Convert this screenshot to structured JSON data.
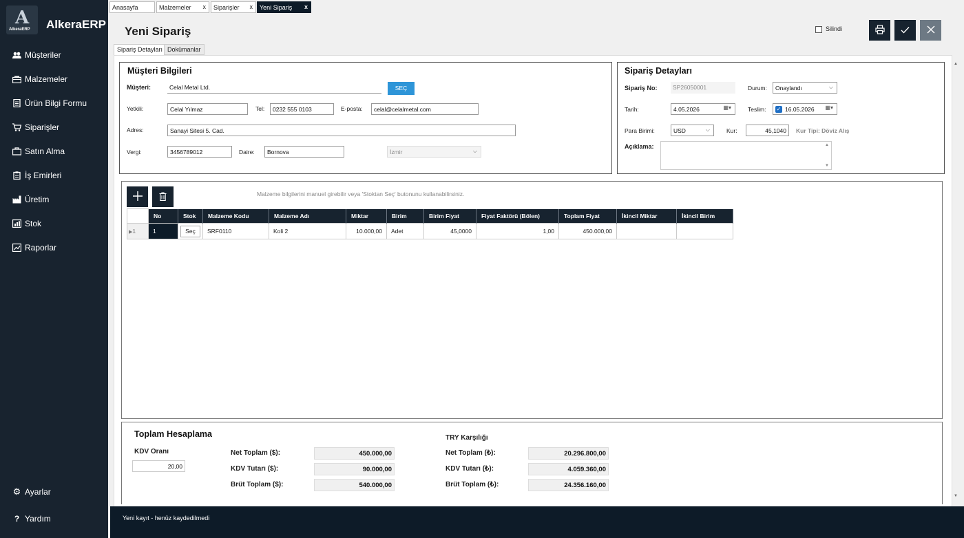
{
  "app": {
    "logo_sub": "AlkeraERP",
    "title": "AlkeraERP"
  },
  "nav": [
    {
      "label": "Müşteriler",
      "icon": "users-icon"
    },
    {
      "label": "Malzemeler",
      "icon": "box-icon"
    },
    {
      "label": "Ürün Bilgi Formu",
      "icon": "document-icon"
    },
    {
      "label": "Siparişler",
      "icon": "cart-icon"
    },
    {
      "label": "Satın Alma",
      "icon": "purchase-icon"
    },
    {
      "label": "İş Emirleri",
      "icon": "clipboard-icon"
    },
    {
      "label": "Üretim",
      "icon": "factory-icon"
    },
    {
      "label": "Stok",
      "icon": "stock-icon"
    },
    {
      "label": "Raporlar",
      "icon": "chart-icon"
    }
  ],
  "nav_bottom": [
    {
      "label": "Ayarlar",
      "icon": "gear-icon"
    },
    {
      "label": "Yardım",
      "icon": "help-icon"
    }
  ],
  "tabs": [
    {
      "label": "Anasayfa"
    },
    {
      "label": "Malzemeler",
      "close": "x"
    },
    {
      "label": "Siparişler",
      "close": "x"
    },
    {
      "label": "Yeni Sipariş",
      "close": "x"
    }
  ],
  "page": {
    "title": "Yeni Sipariş",
    "deleted_label": "Silindi"
  },
  "subtabs": [
    "Sipariş Detayları",
    "Dokümanlar"
  ],
  "customer": {
    "title": "Müşteri Bilgileri",
    "customer_label": "Müşteri:",
    "customer_value": "Celal Metal Ltd.",
    "select_button": "SEÇ",
    "contact_label": "Yetkili:",
    "contact_value": "Celal Yılmaz",
    "phone_label": "Tel:",
    "phone_value": "0232 555 0103",
    "email_label": "E-posta:",
    "email_value": "celal@celalmetal.com",
    "address_label": "Adres:",
    "address_value": "Sanayi Sitesi 5. Cad.",
    "tax_label": "Vergi:",
    "tax_value": "3456789012",
    "office_label": "Daire:",
    "office_value": "Bornova",
    "city_value": "İzmir"
  },
  "order": {
    "title": "Sipariş Detayları",
    "no_label": "Sipariş No:",
    "no_value": "SP26050001",
    "status_label": "Durum:",
    "status_value": "Onaylandı",
    "date_label": "Tarih:",
    "date_value": "4.05.2026",
    "delivery_label": "Teslim:",
    "delivery_value": "16.05.2026",
    "currency_label": "Para Birimi:",
    "currency_value": "USD",
    "rate_label": "Kur:",
    "rate_value": "45,1040",
    "rate_type": "Kur Tipi: Döviz Alış",
    "note_label": "Açıklama:"
  },
  "items": {
    "hint": "Malzeme bilgilerini manuel girebilir veya 'Stoktan Seç' butonunu kullanabilirsiniz.",
    "columns": [
      "No",
      "Stok",
      "Malzeme Kodu",
      "Malzeme Adı",
      "Miktar",
      "Birim",
      "Birim Fiyat",
      "Fiyat Faktörü (Bölen)",
      "Toplam Fiyat",
      "İkincil Miktar",
      "İkincil Birim"
    ],
    "rows": [
      {
        "rowhdr": "1",
        "no": "1",
        "stok": "Seç",
        "code": "SRF0110",
        "name": "Koli 2",
        "qty": "10.000,00",
        "unit": "Adet",
        "price": "45,0000",
        "factor": "1,00",
        "total": "450.000,00",
        "qty2": "",
        "unit2": ""
      }
    ]
  },
  "totals": {
    "title": "Toplam Hesaplama",
    "vat_rate_label": "KDV Oranı",
    "vat_rate_value": "20,00",
    "net_label": "Net Toplam ($):",
    "net_value": "450.000,00",
    "vat_label": "KDV Tutarı ($):",
    "vat_value": "90.000,00",
    "gross_label": "Brüt Toplam ($):",
    "gross_value": "540.000,00",
    "try_title": "TRY Karşılığı",
    "try_net_label": "Net Toplam (₺):",
    "try_net_value": "20.296.800,00",
    "try_vat_label": "KDV Tutarı (₺):",
    "try_vat_value": "4.059.360,00",
    "try_gross_label": "Brüt Toplam (₺):",
    "try_gross_value": "24.356.160,00"
  },
  "status": "Yeni kayıt - henüz kaydedilmedi"
}
